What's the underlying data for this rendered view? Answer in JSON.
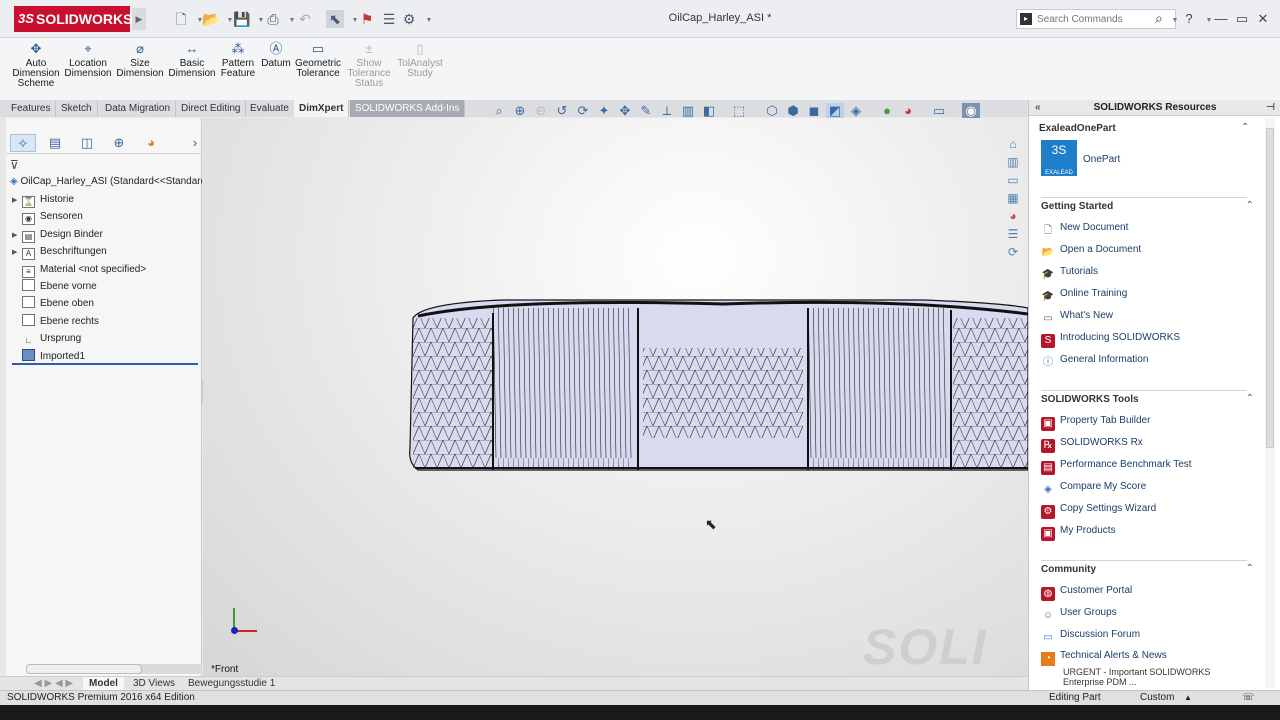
{
  "app": {
    "brand": "SOLIDWORKS",
    "title": "OilCap_Harley_ASI *"
  },
  "search": {
    "placeholder": "Search Commands"
  },
  "window_controls": {
    "help": "?",
    "minimize": "—",
    "restore": "▭",
    "close": "✕"
  },
  "commands": [
    {
      "label": "Auto Dimension Scheme",
      "icon": "auto-dimension-icon",
      "enabled": true
    },
    {
      "label": "Location Dimension",
      "icon": "location-dimension-icon",
      "enabled": true
    },
    {
      "label": "Size Dimension",
      "icon": "size-dimension-icon",
      "enabled": true
    },
    {
      "label": "Basic Dimension",
      "icon": "basic-dimension-icon",
      "enabled": true
    },
    {
      "label": "Pattern Feature",
      "icon": "pattern-feature-icon",
      "enabled": true
    },
    {
      "label": "Datum",
      "icon": "datum-icon",
      "enabled": true
    },
    {
      "label": "Geometric Tolerance",
      "icon": "geometric-tolerance-icon",
      "enabled": true
    },
    {
      "label": "Show Tolerance Status",
      "icon": "show-tolerance-icon",
      "enabled": false
    },
    {
      "label": "TolAnalyst Study",
      "icon": "tolanalyst-icon",
      "enabled": false
    }
  ],
  "tabs": [
    "Features",
    "Sketch",
    "Data Migration",
    "Direct Editing",
    "Evaluate",
    "DimXpert",
    "SOLIDWORKS Add-Ins"
  ],
  "active_tab": "DimXpert",
  "tree": {
    "root": "OilCap_Harley_ASI  (Standard<<Standard",
    "nodes": [
      "Historie",
      "Sensoren",
      "Design Binder",
      "Beschriftungen",
      "Material <not specified>",
      "Ebene vorne",
      "Ebene oben",
      "Ebene rechts",
      "Ursprung",
      "Imported1"
    ]
  },
  "viewport": {
    "view_name": "*Front",
    "watermark": "SOLI"
  },
  "taskpane": {
    "title": "SOLIDWORKS Resources",
    "exalead": {
      "title": "ExaleadOnePart",
      "item": "OnePart",
      "logo_text": "EXALEAD"
    },
    "getting_started": {
      "title": "Getting Started",
      "items": [
        "New Document",
        "Open a Document",
        "Tutorials",
        "Online Training",
        "What's New",
        "Introducing SOLIDWORKS",
        "General Information"
      ]
    },
    "tools": {
      "title": "SOLIDWORKS Tools",
      "items": [
        "Property Tab Builder",
        "SOLIDWORKS Rx",
        "Performance Benchmark Test",
        "Compare My Score",
        "Copy Settings Wizard",
        "My Products"
      ]
    },
    "community": {
      "title": "Community",
      "items": [
        "Customer Portal",
        "User Groups",
        "Discussion Forum",
        "Technical Alerts & News"
      ],
      "news": "URGENT - Important SOLIDWORKS Enterprise PDM ..."
    }
  },
  "bottom_tabs": [
    "Model",
    "3D Views",
    "Bewegungsstudie 1"
  ],
  "status": {
    "edition": "SOLIDWORKS Premium 2016 x64 Edition",
    "mode": "Editing Part",
    "units": "Custom"
  },
  "colors": {
    "brand": "#c8102e",
    "accent": "#2a5db0",
    "mesh_fill": "#d8d8f0"
  }
}
